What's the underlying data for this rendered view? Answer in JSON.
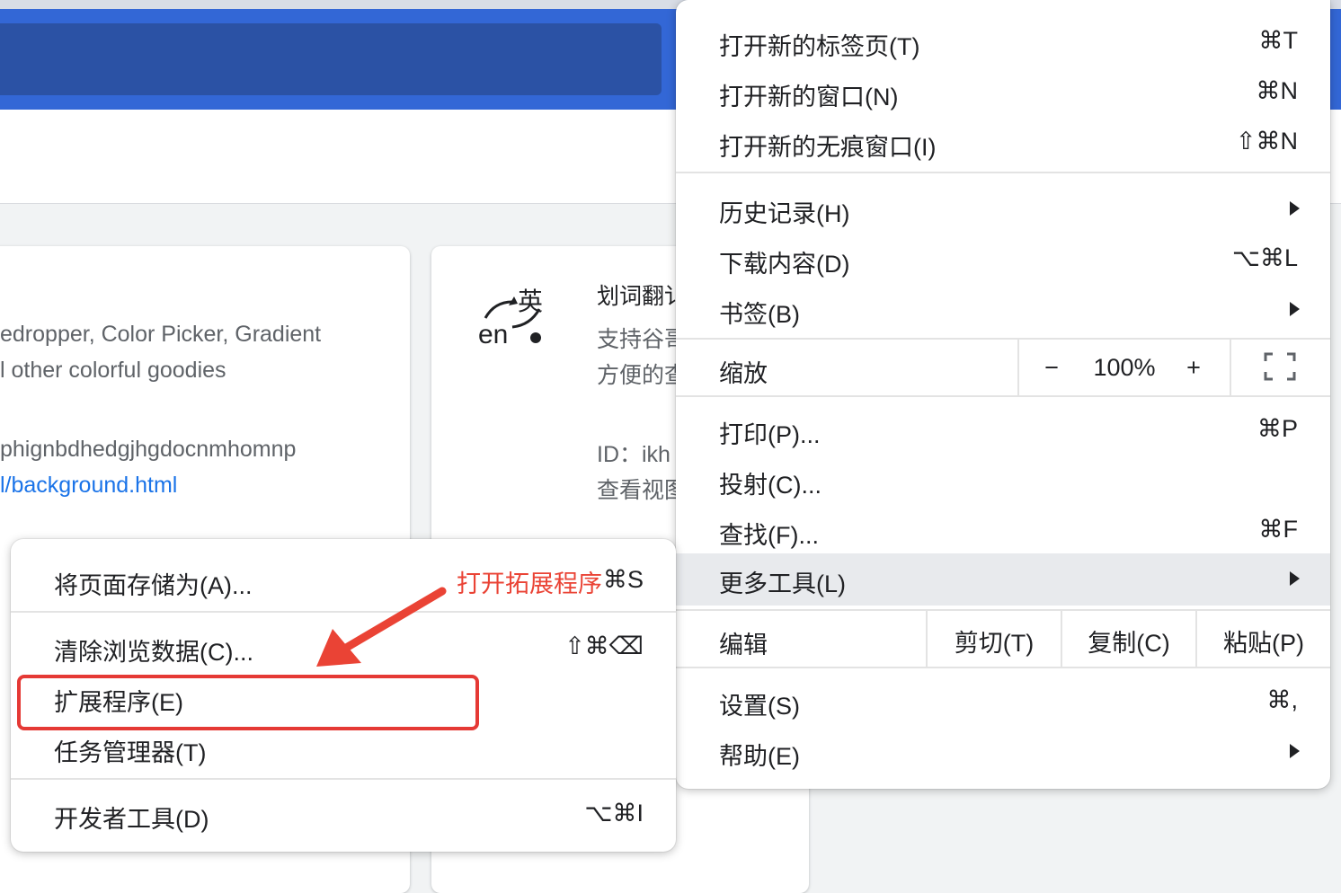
{
  "background": {
    "card1": {
      "line_partial": ")",
      "desc1": "edropper, Color Picker, Gradient",
      "desc2": "l other colorful goodies",
      "id": "phignbdhedgjhgdocnmhomnp",
      "link": "l/background.html"
    },
    "card2": {
      "logo_cn": "英",
      "logo_en": "en",
      "title": "划词翻讠",
      "desc1": "支持谷哥",
      "desc2": "方便的查",
      "id": "ID：ikh",
      "view": "查看视图"
    }
  },
  "main_menu": {
    "items": [
      {
        "label": "打开新的标签页(T)",
        "shortcut": "⌘T"
      },
      {
        "label": "打开新的窗口(N)",
        "shortcut": "⌘N"
      },
      {
        "label": "打开新的无痕窗口(I)",
        "shortcut": "⇧⌘N"
      },
      {
        "label": "历史记录(H)",
        "shortcut": ""
      },
      {
        "label": "下载内容(D)",
        "shortcut": "⌥⌘L"
      },
      {
        "label": "书签(B)",
        "shortcut": ""
      },
      {
        "label": "打印(P)...",
        "shortcut": "⌘P"
      },
      {
        "label": "投射(C)...",
        "shortcut": ""
      },
      {
        "label": "查找(F)...",
        "shortcut": "⌘F"
      },
      {
        "label": "更多工具(L)",
        "shortcut": ""
      },
      {
        "label": "设置(S)",
        "shortcut": "⌘,"
      },
      {
        "label": "帮助(E)",
        "shortcut": ""
      }
    ],
    "zoom": {
      "label": "缩放",
      "minus": "−",
      "value": "100%",
      "plus": "+"
    },
    "edit": {
      "label": "编辑",
      "cut": "剪切(T)",
      "copy": "复制(C)",
      "paste": "粘贴(P)"
    }
  },
  "sub_menu": {
    "items": [
      {
        "label": "将页面存储为(A)...",
        "shortcut": "⌘S"
      },
      {
        "label": "清除浏览数据(C)...",
        "shortcut": "⇧⌘⌫"
      },
      {
        "label": "扩展程序(E)",
        "shortcut": ""
      },
      {
        "label": "任务管理器(T)",
        "shortcut": ""
      },
      {
        "label": "开发者工具(D)",
        "shortcut": "⌥⌘I"
      }
    ]
  },
  "annotation": {
    "text": "打开拓展程序",
    "color": "#ea4335"
  },
  "colors": {
    "header": "#3367d6",
    "highlight": "#e8eaed",
    "annotation_box": "#e53935"
  }
}
